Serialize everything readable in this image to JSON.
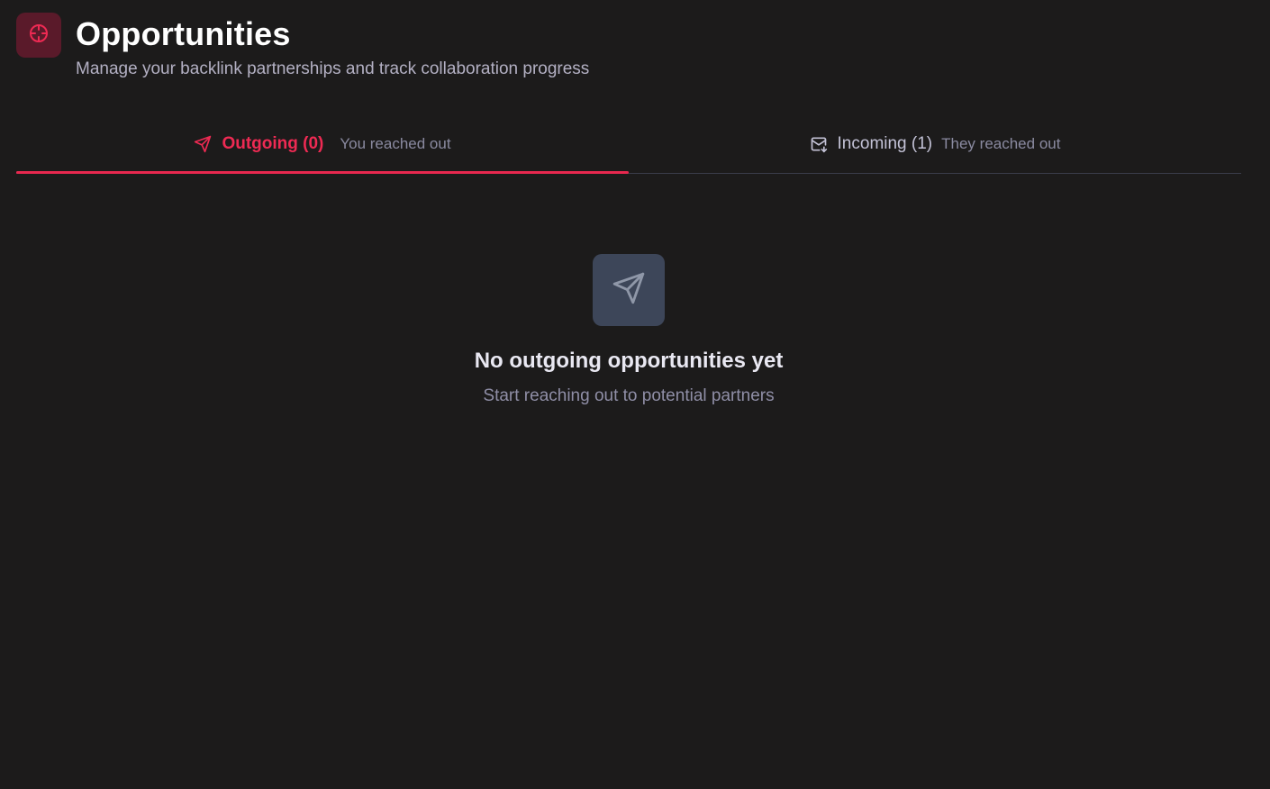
{
  "header": {
    "logo_icon": "crosshair-icon",
    "title": "Opportunities",
    "subtitle": "Manage your backlink partnerships and track collaboration progress"
  },
  "tabs": [
    {
      "icon": "send-icon",
      "label": "Outgoing (0)",
      "sub": "You reached out",
      "active": true
    },
    {
      "icon": "mail-incoming-icon",
      "label": "Incoming (1)",
      "sub": "They reached out",
      "active": false
    }
  ],
  "empty_state": {
    "icon": "send-icon",
    "title": "No outgoing opportunities yet",
    "subtitle": "Start reaching out to potential partners"
  },
  "colors": {
    "background": "#1c1b1b",
    "accent": "#e8284f",
    "logo_bg": "#5a1a2a",
    "empty_icon_bg": "#3d4659"
  }
}
